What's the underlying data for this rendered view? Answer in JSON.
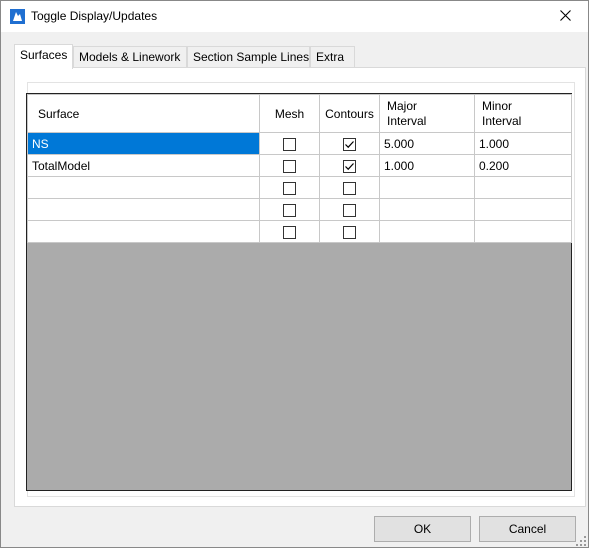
{
  "window": {
    "title": "Toggle Display/Updates"
  },
  "tabs": [
    {
      "label": "Surfaces",
      "active": true
    },
    {
      "label": "Models & Linework",
      "active": false
    },
    {
      "label": "Section Sample Lines",
      "active": false
    },
    {
      "label": "Extra",
      "active": false
    }
  ],
  "table": {
    "headers": {
      "surface": "Surface",
      "mesh": "Mesh",
      "contours": "Contours",
      "major_line1": "Major",
      "major_line2": "Interval",
      "minor_line1": "Minor",
      "minor_line2": "Interval"
    },
    "rows": [
      {
        "surface": "NS",
        "mesh": false,
        "contours": true,
        "major": "5.000",
        "minor": "1.000",
        "selected": true
      },
      {
        "surface": "TotalModel",
        "mesh": false,
        "contours": true,
        "major": "1.000",
        "minor": "0.200",
        "selected": false
      },
      {
        "surface": "",
        "mesh": false,
        "contours": false,
        "major": "",
        "minor": "",
        "selected": false
      },
      {
        "surface": "",
        "mesh": false,
        "contours": false,
        "major": "",
        "minor": "",
        "selected": false
      },
      {
        "surface": "",
        "mesh": false,
        "contours": false,
        "major": "",
        "minor": "",
        "selected": false
      }
    ]
  },
  "buttons": {
    "ok": "OK",
    "cancel": "Cancel"
  },
  "colors": {
    "selection": "#0078d7",
    "grid_background": "#ababab",
    "window_background": "#f0f0f0"
  },
  "icons": {
    "app": "app-logo-icon",
    "close": "close-icon",
    "check": "checkmark-icon",
    "grip": "resize-grip-icon"
  }
}
